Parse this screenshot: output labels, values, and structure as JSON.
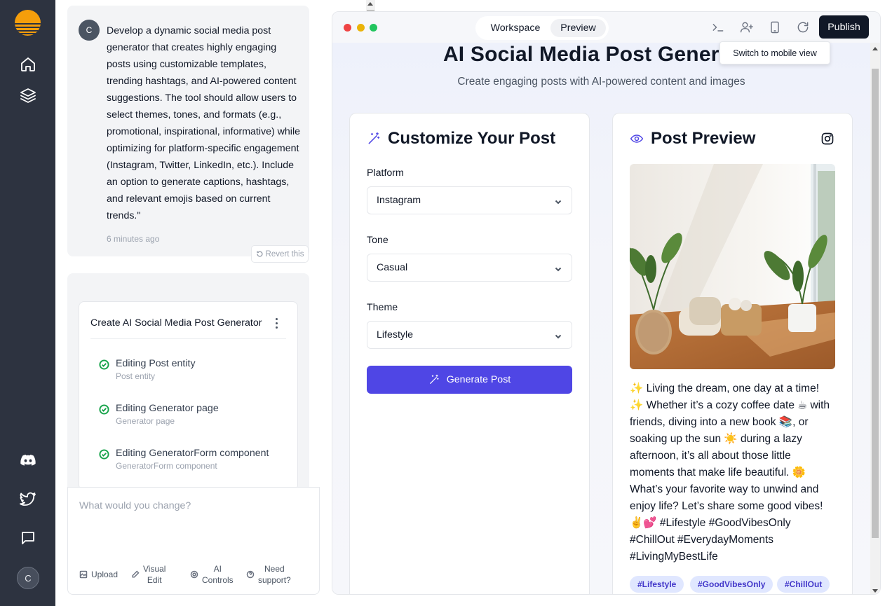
{
  "rail": {
    "user_initial": "C",
    "icons": [
      "logo-icon",
      "home-icon",
      "layers-icon",
      "discord-icon",
      "twitter-icon",
      "chat-icon"
    ]
  },
  "chat": {
    "message": {
      "avatar_initial": "C",
      "text": "Develop a dynamic social media post generator that creates highly engaging posts using customizable templates, trending hashtags, and AI-powered content suggestions. The tool should allow users to select themes, tones, and formats (e.g., promotional, inspirational, informative) while optimizing for platform-specific engagement (Instagram, Twitter, LinkedIn, etc.). Include an option to generate captions, hashtags, and relevant emojis based on current trends.\"",
      "time": "6 minutes ago",
      "revert_label": "Revert this"
    },
    "task": {
      "title": "Create AI Social Media Post Generator",
      "steps": [
        {
          "label": "Editing Post entity",
          "sub": "Post entity"
        },
        {
          "label": "Editing Generator page",
          "sub": "Generator page"
        },
        {
          "label": "Editing GeneratorForm component",
          "sub": "GeneratorForm component"
        }
      ]
    },
    "input": {
      "placeholder": "What would you change?",
      "tools": {
        "upload": "Upload",
        "visual_edit_1": "Visual",
        "visual_edit_2": "Edit",
        "ai_controls_1": "AI",
        "ai_controls_2": "Controls",
        "support_1": "Need",
        "support_2": "support?"
      }
    }
  },
  "toolbar": {
    "tab_workspace": "Workspace",
    "tab_preview": "Preview",
    "active_tab": "Preview",
    "publish_label": "Publish",
    "tooltip": "Switch to mobile view"
  },
  "app": {
    "title": "AI Social Media Post Generator",
    "subtitle": "Create engaging posts with AI-powered content and images",
    "customize": {
      "heading": "Customize Your Post",
      "platform_label": "Platform",
      "platform_value": "Instagram",
      "tone_label": "Tone",
      "tone_value": "Casual",
      "theme_label": "Theme",
      "theme_value": "Lifestyle",
      "generate_label": "Generate Post"
    },
    "preview": {
      "heading": "Post Preview",
      "caption": "✨ Living the dream, one day at a time! ✨ Whether it’s a cozy coffee date ☕ with friends, diving into a new book 📚, or soaking up the sun ☀️ during a lazy afternoon, it’s all about those little moments that make life beautiful. 🌼 What’s your favorite way to unwind and enjoy life? Let’s share some good vibes! ✌️💕 #Lifestyle #GoodVibesOnly #ChillOut #EverydayMoments #LivingMyBestLife",
      "tags": [
        "#Lifestyle",
        "#GoodVibesOnly",
        "#ChillOut"
      ]
    }
  },
  "colors": {
    "rail_bg": "#2d3340",
    "brand": "#f59e0b",
    "primary": "#4f46e5",
    "publish_bg": "#111827",
    "tag_bg": "#e0e7ff",
    "tag_text": "#4338ca",
    "check_green": "#16a34a"
  }
}
